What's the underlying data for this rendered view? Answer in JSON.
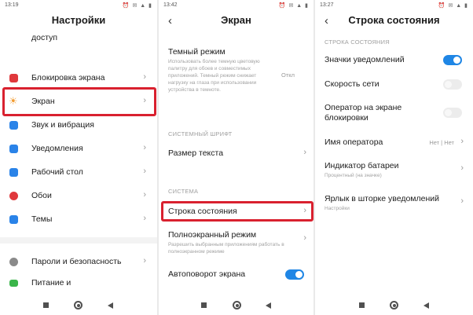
{
  "screen1": {
    "status_time": "13:19",
    "status_icons": "⏰ ✉ ▲ ▮",
    "title": "Настройки",
    "cut_top_label": "доступ",
    "items": [
      {
        "label": "Блокировка экрана",
        "icon": "lock-icon",
        "color": "#e0383c"
      },
      {
        "label": "Экран",
        "icon": "sun-icon",
        "color": "#f29b30"
      },
      {
        "label": "Звук и вибрация",
        "icon": "speaker-icon",
        "color": "#2a83e8"
      },
      {
        "label": "Уведомления",
        "icon": "bell-icon",
        "color": "#2a83e8"
      },
      {
        "label": "Рабочий стол",
        "icon": "home-icon",
        "color": "#2a83e8"
      },
      {
        "label": "Обои",
        "icon": "flower-icon",
        "color": "#e0383c"
      },
      {
        "label": "Темы",
        "icon": "brush-icon",
        "color": "#2a83e8"
      },
      {
        "label": "Пароли и безопасность",
        "icon": "gear-icon",
        "color": "#8a8a8a"
      },
      {
        "label": "Питание и",
        "icon": "battery-icon",
        "color": "#3ab54a"
      }
    ]
  },
  "screen2": {
    "status_time": "13:42",
    "status_icons": "⏰ ✉ ▲ ▮",
    "title": "Экран",
    "dark_mode": {
      "label": "Темный режим",
      "desc": "Использовать более темную цветовую палитру для обоев и совместимых приложений. Темный режим снижает нагрузку на глаза при использовании устройства в темноте.",
      "value": "Откл"
    },
    "section_font": "СИСТЕМНЫЙ ШРИФТ",
    "text_size": "Размер текста",
    "section_system": "СИСТЕМА",
    "status_bar": "Строка состояния",
    "fullscreen": {
      "label": "Полноэкранный режим",
      "desc": "Разрешить выбранным приложениям работать в полноэкранном режиме"
    },
    "autorotate": {
      "label": "Автоповорот экрана",
      "on": true
    }
  },
  "screen3": {
    "status_time": "13:27",
    "status_icons": "⏰ ✉ ▲ ▮",
    "title": "Строка состояния",
    "section": "СТРОКА СОСТОЯНИЯ",
    "notif_icons": {
      "label": "Значки уведомлений",
      "on": true
    },
    "net_speed": {
      "label": "Скорость сети",
      "on": false
    },
    "lock_operator": {
      "label": "Оператор на экране блокировки",
      "on": false
    },
    "operator_name": {
      "label": "Имя оператора",
      "value": "Нет | Нет"
    },
    "battery": {
      "label": "Индикатор батареи",
      "desc": "Процентный (на значке)"
    },
    "shade_label": {
      "label": "Ярлык в шторке уведомлений",
      "desc": "Настройки"
    }
  },
  "colors": {
    "accent": "#1f86e5",
    "highlight": "#d9212f"
  }
}
